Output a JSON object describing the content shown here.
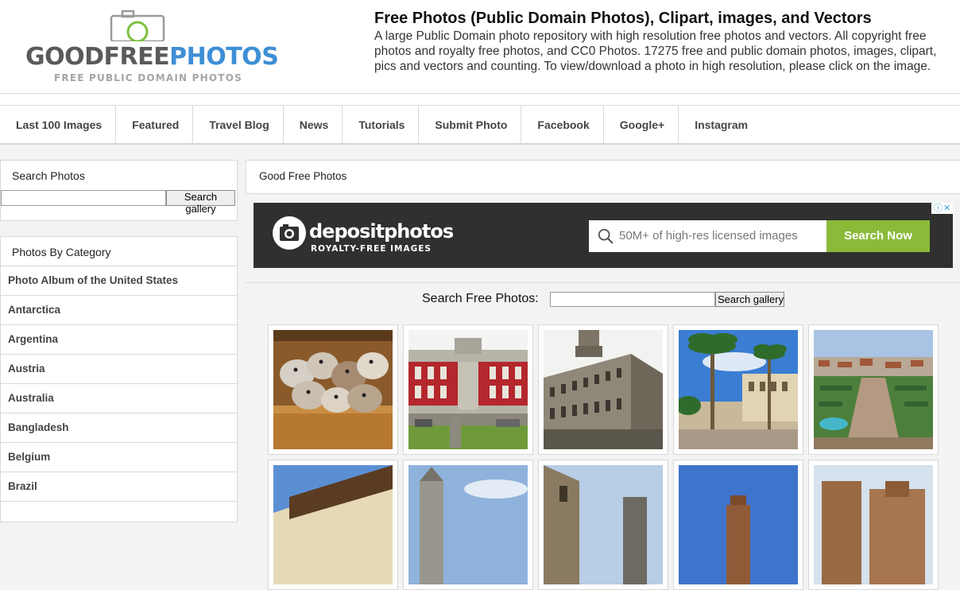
{
  "header": {
    "logo": {
      "word_good": "GOODFREE",
      "word_photos": "PHOTOS",
      "tagline": "FREE PUBLIC DOMAIN PHOTOS"
    },
    "title": "Free Photos (Public Domain Photos), Clipart, images, and Vectors",
    "description": "A large Public Domain photo repository with high resolution free photos and vectors. All copyright free photos and royalty free photos, and CC0 Photos. 17275 free and public domain photos, images, clipart, pics and vectors and counting. To view/download a photo in high resolution, please click on the image."
  },
  "nav": {
    "items": [
      {
        "label": "Last 100 Images"
      },
      {
        "label": "Featured"
      },
      {
        "label": "Travel Blog"
      },
      {
        "label": "News"
      },
      {
        "label": "Tutorials"
      },
      {
        "label": "Submit Photo"
      },
      {
        "label": "Facebook"
      },
      {
        "label": "Google+"
      },
      {
        "label": "Instagram"
      }
    ]
  },
  "sidebar": {
    "search": {
      "title": "Search Photos",
      "value": "",
      "button": "Search gallery"
    },
    "categories": {
      "title": "Photos By Category",
      "items": [
        "Photo Album of the United States",
        "Antarctica",
        "Argentina",
        "Austria",
        "Australia",
        "Bangladesh",
        "Belgium",
        "Brazil"
      ]
    }
  },
  "main": {
    "breadcrumb": "Good Free Photos",
    "ad": {
      "brand": "depositphotos",
      "sub": "ROYALTY-FREE IMAGES",
      "search_placeholder": "50M+ of high-res licensed images",
      "button": "Search Now"
    },
    "search": {
      "label": "Search Free Photos:",
      "value": "",
      "button": "Search gallery"
    }
  },
  "colors": {
    "logo_gray": "#5a5a5a",
    "logo_blue": "#3e8fd6",
    "logo_green": "#7cc142",
    "ad_green": "#8bba3a",
    "ad_bg": "#303030",
    "page_bg": "#f4f3f3"
  }
}
